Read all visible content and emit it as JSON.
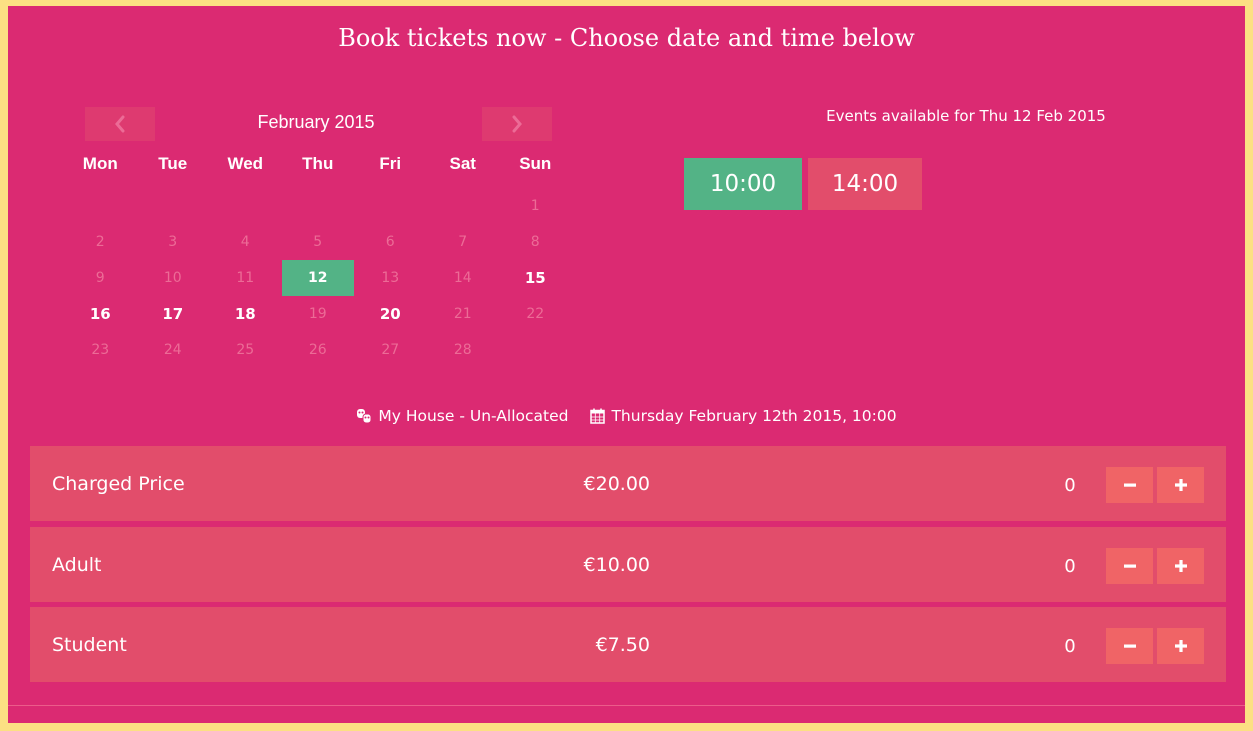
{
  "page": {
    "title": "Book tickets now - Choose date and time below"
  },
  "calendar": {
    "month_label": "February 2015",
    "prev_icon": "chevron-left-icon",
    "next_icon": "chevron-right-icon",
    "weekdays": [
      "Mon",
      "Tue",
      "Wed",
      "Thu",
      "Fri",
      "Sat",
      "Sun"
    ],
    "leading_blanks": 6,
    "days": [
      {
        "label": "1",
        "state": "unavailable"
      },
      {
        "label": "2",
        "state": "unavailable"
      },
      {
        "label": "3",
        "state": "unavailable"
      },
      {
        "label": "4",
        "state": "unavailable"
      },
      {
        "label": "5",
        "state": "unavailable"
      },
      {
        "label": "6",
        "state": "unavailable"
      },
      {
        "label": "7",
        "state": "unavailable"
      },
      {
        "label": "8",
        "state": "unavailable"
      },
      {
        "label": "9",
        "state": "unavailable"
      },
      {
        "label": "10",
        "state": "unavailable"
      },
      {
        "label": "11",
        "state": "unavailable"
      },
      {
        "label": "12",
        "state": "selected"
      },
      {
        "label": "13",
        "state": "unavailable"
      },
      {
        "label": "14",
        "state": "unavailable"
      },
      {
        "label": "15",
        "state": "available"
      },
      {
        "label": "16",
        "state": "available"
      },
      {
        "label": "17",
        "state": "available"
      },
      {
        "label": "18",
        "state": "available"
      },
      {
        "label": "19",
        "state": "unavailable"
      },
      {
        "label": "20",
        "state": "available"
      },
      {
        "label": "21",
        "state": "unavailable"
      },
      {
        "label": "22",
        "state": "unavailable"
      },
      {
        "label": "23",
        "state": "unavailable"
      },
      {
        "label": "24",
        "state": "unavailable"
      },
      {
        "label": "25",
        "state": "unavailable"
      },
      {
        "label": "26",
        "state": "unavailable"
      },
      {
        "label": "27",
        "state": "unavailable"
      },
      {
        "label": "28",
        "state": "unavailable"
      }
    ]
  },
  "events": {
    "heading": "Events available for Thu 12 Feb 2015",
    "times": [
      {
        "label": "10:00",
        "state": "selected"
      },
      {
        "label": "14:00",
        "state": "default"
      }
    ]
  },
  "venue": {
    "icon": "theater-masks-icon",
    "name": "My House - Un-Allocated",
    "date_icon": "calendar-icon",
    "datetime": "Thursday February 12th 2015, 10:00"
  },
  "prices": [
    {
      "label": "Charged Price",
      "price": "€20.00",
      "qty": "0"
    },
    {
      "label": "Adult",
      "price": "€10.00",
      "qty": "0"
    },
    {
      "label": "Student",
      "price": "€7.50",
      "qty": "0"
    }
  ],
  "controls": {
    "minus_icon": "minus-icon",
    "plus_icon": "plus-icon"
  },
  "colors": {
    "background": "#db2a72",
    "border": "#fce083",
    "selected": "#53b386",
    "row": "#e24d6b",
    "qty_button": "#f06466"
  }
}
